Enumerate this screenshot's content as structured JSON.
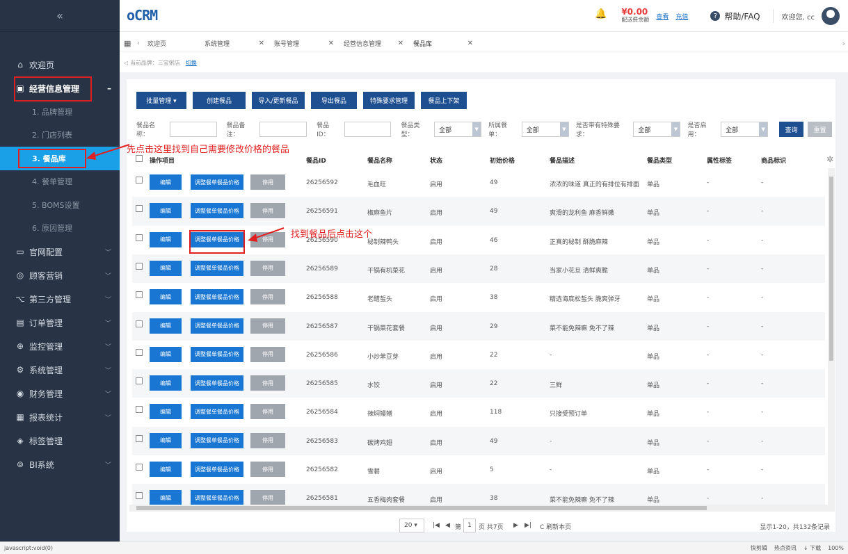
{
  "sidebar": {
    "collapse_icon": "«",
    "welcome": "欢迎页",
    "group_business": "经营信息管理",
    "group_business_toggle": "–",
    "sub_items": [
      "1. 品牌管理",
      "2. 门店列表",
      "3. 餐品库",
      "4. 餐单管理",
      "5. BOMS设置",
      "6. 原因管理"
    ],
    "groups": [
      "官网配置",
      "顾客营销",
      "第三方管理",
      "订单管理",
      "监控管理",
      "系统管理",
      "财务管理",
      "报表统计",
      "标签管理",
      "BI系统"
    ]
  },
  "topbar": {
    "logo": "oCRM",
    "balance_amount": "¥0.00",
    "balance_label": "配送费余额",
    "link_view": "查看",
    "link_recharge": "充值",
    "help": "帮助/FAQ",
    "welcome": "欢迎您, cc"
  },
  "tabs": {
    "items": [
      "欢迎页",
      "系统管理",
      "账号管理",
      "经营信息管理",
      "餐品库"
    ]
  },
  "brand": {
    "label": "当前品牌：三宝粥店",
    "switch": "切换"
  },
  "toolbar": {
    "buttons": [
      "批量管理 ▾",
      "创建餐品",
      "导入/更新餐品",
      "导出餐品",
      "特殊要求管理",
      "餐品上下架"
    ]
  },
  "filters": {
    "name_label": "餐品名称：",
    "remark_label": "餐品备注：",
    "id_label": "餐品ID：",
    "type_label": "餐品类型：",
    "type_value": "全部",
    "menu_label": "所属餐单：",
    "menu_value": "全部",
    "special_label": "是否带有特殊要求：",
    "special_value": "全部",
    "enabled_label": "是否启用：",
    "enabled_value": "全部",
    "query": "查询",
    "reset": "重置"
  },
  "table": {
    "headers": [
      "操作项目",
      "餐品ID",
      "餐品名称",
      "状态",
      "初始价格",
      "餐品描述",
      "餐品类型",
      "属性标签",
      "商品标识"
    ],
    "edit_label": "编辑",
    "adjust_label": "调整餐单餐品价格",
    "stop_label": "停用",
    "rows": [
      {
        "id": "26256592",
        "name": "毛血旺",
        "status": "启用",
        "price": "49",
        "desc": "浓浓的味道 真正的有排位有排面",
        "type": "单品",
        "attr": "-",
        "mark": "-"
      },
      {
        "id": "26256591",
        "name": "椒麻鱼片",
        "status": "启用",
        "price": "49",
        "desc": "爽滑的龙利鱼 麻香鲜嫩",
        "type": "单品",
        "attr": "-",
        "mark": "-"
      },
      {
        "id": "26256590",
        "name": "秘制辣鸭头",
        "status": "启用",
        "price": "46",
        "desc": "正真的秘制 酥脆麻辣",
        "type": "单品",
        "attr": "-",
        "mark": "-"
      },
      {
        "id": "26256589",
        "name": "干锅有机菜花",
        "status": "启用",
        "price": "28",
        "desc": "当家小花旦 清鲜爽脆",
        "type": "单品",
        "attr": "-",
        "mark": "-"
      },
      {
        "id": "26256588",
        "name": "老醋蜇头",
        "status": "启用",
        "price": "38",
        "desc": "精选海底松蜇头 脆爽弹牙",
        "type": "单品",
        "attr": "-",
        "mark": "-"
      },
      {
        "id": "26256587",
        "name": "干锅菜花套餐",
        "status": "启用",
        "price": "29",
        "desc": "菜不能免辣嘛 免不了辣",
        "type": "单品",
        "attr": "-",
        "mark": "-"
      },
      {
        "id": "26256586",
        "name": "小炒苯豆芽",
        "status": "启用",
        "price": "22",
        "desc": "-",
        "type": "单品",
        "attr": "-",
        "mark": "-"
      },
      {
        "id": "26256585",
        "name": "水饺",
        "status": "启用",
        "price": "22",
        "desc": "三鲜",
        "type": "单品",
        "attr": "-",
        "mark": "-"
      },
      {
        "id": "26256584",
        "name": "辣焖鳗鳝",
        "status": "启用",
        "price": "118",
        "desc": "只接受预订单",
        "type": "单品",
        "attr": "-",
        "mark": "-"
      },
      {
        "id": "26256583",
        "name": "碳烤鸡翅",
        "status": "启用",
        "price": "49",
        "desc": "-",
        "type": "单品",
        "attr": "-",
        "mark": "-"
      },
      {
        "id": "26256582",
        "name": "雪碧",
        "status": "启用",
        "price": "5",
        "desc": "-",
        "type": "单品",
        "attr": "-",
        "mark": "-"
      },
      {
        "id": "26256581",
        "name": "五香梅肉套餐",
        "status": "启用",
        "price": "38",
        "desc": "菜不能免辣嘛 免不了辣",
        "type": "单品",
        "attr": "-",
        "mark": "-"
      }
    ]
  },
  "pager": {
    "page_size": "20 ▾",
    "first": "|◀",
    "prev": "◀",
    "page_prefix": "第",
    "current_page": "1",
    "page_suffix": "页 共7页",
    "next": "▶",
    "last": "▶|",
    "refresh": "C 刷新本页",
    "info": "显示1-20，共132条记录"
  },
  "status": {
    "url": "javascript:void(0)",
    "items": [
      "快剪辑",
      "热点资讯",
      "↓ 下载",
      "100%"
    ]
  },
  "annotations": {
    "step1": "先点击这里找到自己需要修改价格的餐品",
    "step2": "找到餐品后点击这个"
  },
  "colors": {
    "accent": "#1aa0e6",
    "primary": "#1e4f91",
    "annotation": "#e02020"
  }
}
